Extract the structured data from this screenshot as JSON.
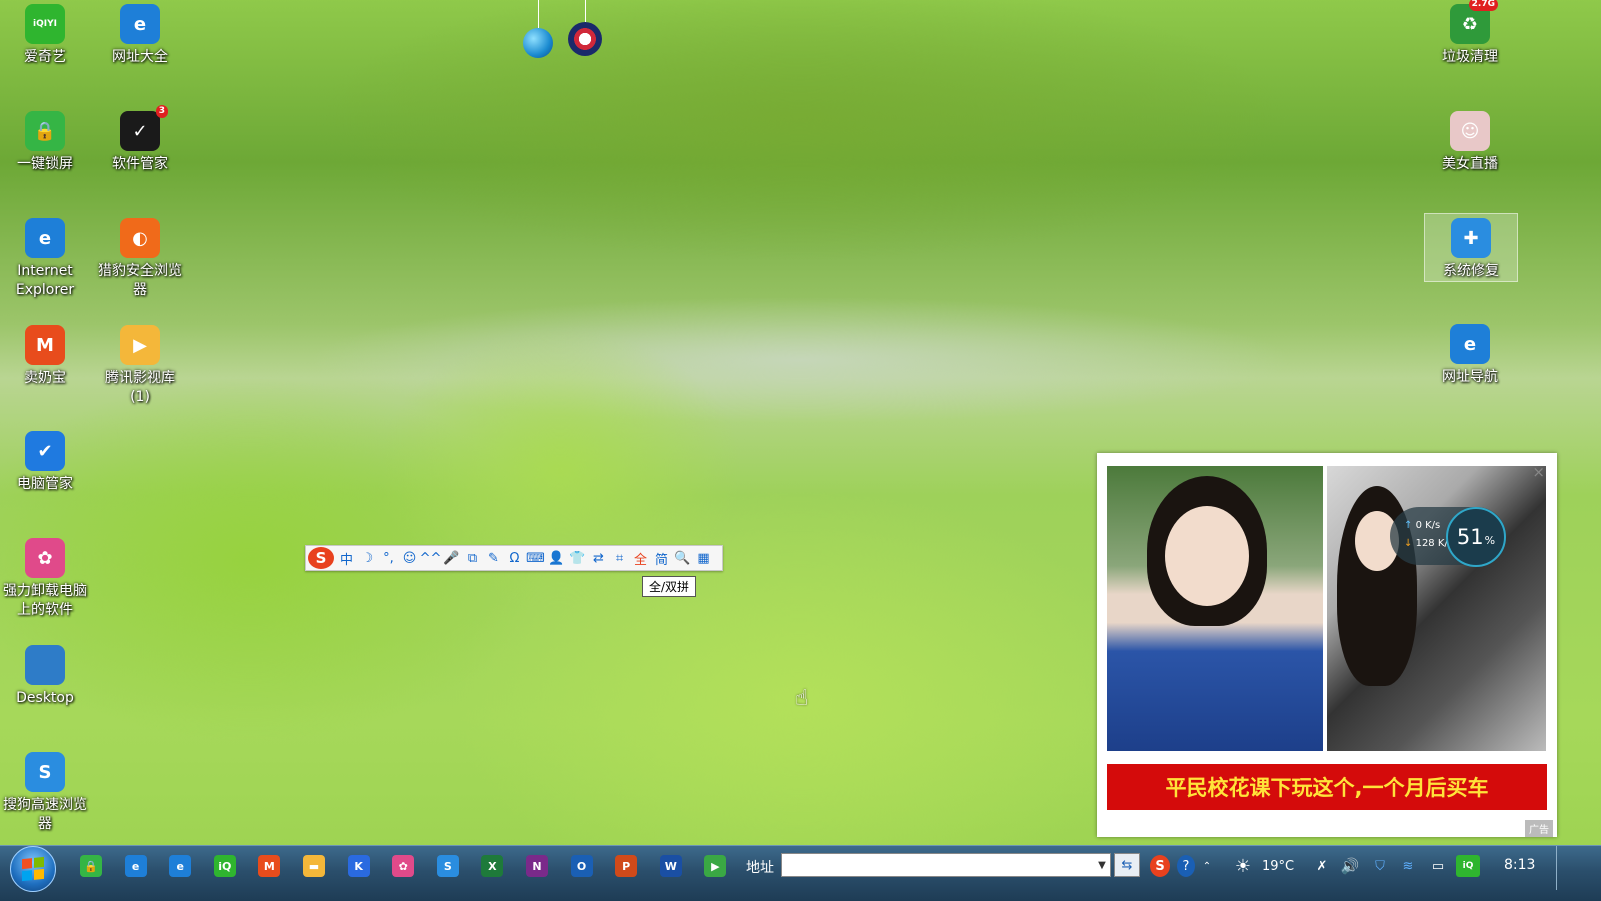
{
  "desktop_icons_left": [
    {
      "label": "爱奇艺",
      "icon": "iqiyi-icon",
      "color": "#2fb52f",
      "glyph": "iQIYI"
    },
    {
      "label": "网址大全",
      "icon": "ie-icon",
      "color": "#1e7fd8",
      "glyph": "e"
    },
    {
      "label": "一键锁屏",
      "icon": "lock-shield-icon",
      "color": "#35b545",
      "glyph": "🔒"
    },
    {
      "label": "软件管家",
      "icon": "software-manager-icon",
      "color": "#1a1a1a",
      "glyph": "✓",
      "badge": "3"
    },
    {
      "label": "Internet Explorer",
      "icon": "ie-icon",
      "color": "#1e7fd8",
      "glyph": "e"
    },
    {
      "label": "猎豹安全浏览器",
      "icon": "cheetah-browser-icon",
      "color": "#f06a1a",
      "glyph": "◐"
    },
    {
      "label": "卖奶宝",
      "icon": "mainaibao-icon",
      "color": "#e84c1c",
      "glyph": "M"
    },
    {
      "label": "腾讯影视库 (1)",
      "icon": "tencent-video-folder-icon",
      "color": "#f4b73a",
      "glyph": "▶"
    },
    {
      "label": "电脑管家",
      "icon": "pc-manager-icon",
      "color": "#1f7ae0",
      "glyph": "✔"
    },
    {
      "label": "强力卸载电脑上的软件",
      "icon": "uninstall-icon",
      "color": "#e04a8a",
      "glyph": "✿"
    },
    {
      "label": "Desktop",
      "icon": "monitor-icon",
      "color": "#2e7cc8",
      "glyph": ""
    },
    {
      "label": "搜狗高速浏览器",
      "icon": "sogou-browser-icon",
      "color": "#2a8de0",
      "glyph": "S"
    }
  ],
  "desktop_icons_right": [
    {
      "label": "垃圾清理",
      "icon": "recycle-bin-icon",
      "color": "#2f9a3a",
      "glyph": "♻",
      "badge": "2.7G"
    },
    {
      "label": "美女直播",
      "icon": "live-stream-icon",
      "color": "#e8c8c8",
      "glyph": "☺"
    },
    {
      "label": "系统修复",
      "icon": "system-repair-icon",
      "color": "#2a8de0",
      "glyph": "✚"
    },
    {
      "label": "网址导航",
      "icon": "ie-icon",
      "color": "#1e7fd8",
      "glyph": "e"
    }
  ],
  "ime_toolbar": {
    "buttons": [
      {
        "glyph": "中",
        "name": "ime-lang-toggle"
      },
      {
        "glyph": "☽",
        "name": "ime-halfwidth-toggle"
      },
      {
        "glyph": "°,",
        "name": "ime-punctuation-toggle"
      },
      {
        "glyph": "☺",
        "name": "ime-emoji-button"
      },
      {
        "glyph": "^^",
        "name": "ime-emoticon-button"
      },
      {
        "glyph": "🎤",
        "name": "ime-voice-button"
      },
      {
        "glyph": "⧉",
        "name": "ime-screenshot-button"
      },
      {
        "glyph": "✎",
        "name": "ime-handwrite-button"
      },
      {
        "glyph": "Ω",
        "name": "ime-symbols-button"
      },
      {
        "glyph": "⌨",
        "name": "ime-keyboard-button"
      },
      {
        "glyph": "👤",
        "name": "ime-account-button"
      },
      {
        "glyph": "👕",
        "name": "ime-skin-button"
      },
      {
        "glyph": "⇄",
        "name": "ime-translate-button"
      },
      {
        "glyph": "⌗",
        "name": "ime-crop-button"
      },
      {
        "glyph": "全",
        "name": "ime-full-pinyin-button"
      },
      {
        "glyph": "简",
        "name": "ime-simplified-button"
      },
      {
        "glyph": "🔍",
        "name": "ime-search-button"
      },
      {
        "glyph": "▦",
        "name": "ime-toolbox-button"
      }
    ],
    "tooltip": "全/双拼"
  },
  "ad_popup": {
    "close": "×",
    "banner_text": "平民校花课下玩这个,一个月后买车",
    "tag": "广告"
  },
  "speed_widget": {
    "upload": "0 K/s",
    "download": "128 K/s",
    "percent": "51",
    "percent_unit": "%"
  },
  "taskbar": {
    "apps": [
      {
        "name": "taskbar-lock-icon",
        "color": "#35b545",
        "glyph": "🔒"
      },
      {
        "name": "taskbar-ie-icon",
        "color": "#1e7fd8",
        "glyph": "e"
      },
      {
        "name": "taskbar-ie2-icon",
        "color": "#1e7fd8",
        "glyph": "e"
      },
      {
        "name": "taskbar-iqiyi-icon",
        "color": "#2fb52f",
        "glyph": "iQ"
      },
      {
        "name": "taskbar-mainaibao-icon",
        "color": "#e84c1c",
        "glyph": "M"
      },
      {
        "name": "taskbar-folder-icon",
        "color": "#f4b73a",
        "glyph": "▬"
      },
      {
        "name": "taskbar-k-icon",
        "color": "#2a6ae0",
        "glyph": "K"
      },
      {
        "name": "taskbar-pinwheel-icon",
        "color": "#e04a8a",
        "glyph": "✿"
      },
      {
        "name": "taskbar-sogou-icon",
        "color": "#2a8de0",
        "glyph": "S"
      },
      {
        "name": "taskbar-excel-icon",
        "color": "#1e7a3a",
        "glyph": "X"
      },
      {
        "name": "taskbar-onenote-icon",
        "color": "#7a2a8a",
        "glyph": "N"
      },
      {
        "name": "taskbar-outlook-icon",
        "color": "#1a5fb4",
        "glyph": "O"
      },
      {
        "name": "taskbar-powerpoint-icon",
        "color": "#d04a1a",
        "glyph": "P"
      },
      {
        "name": "taskbar-word-icon",
        "color": "#1a4fa4",
        "glyph": "W"
      },
      {
        "name": "taskbar-player-icon",
        "color": "#3aa844",
        "glyph": "▶"
      }
    ],
    "address_label": "地址",
    "address_value": "",
    "tray": {
      "temperature": "19°C",
      "time": "8:13"
    }
  }
}
